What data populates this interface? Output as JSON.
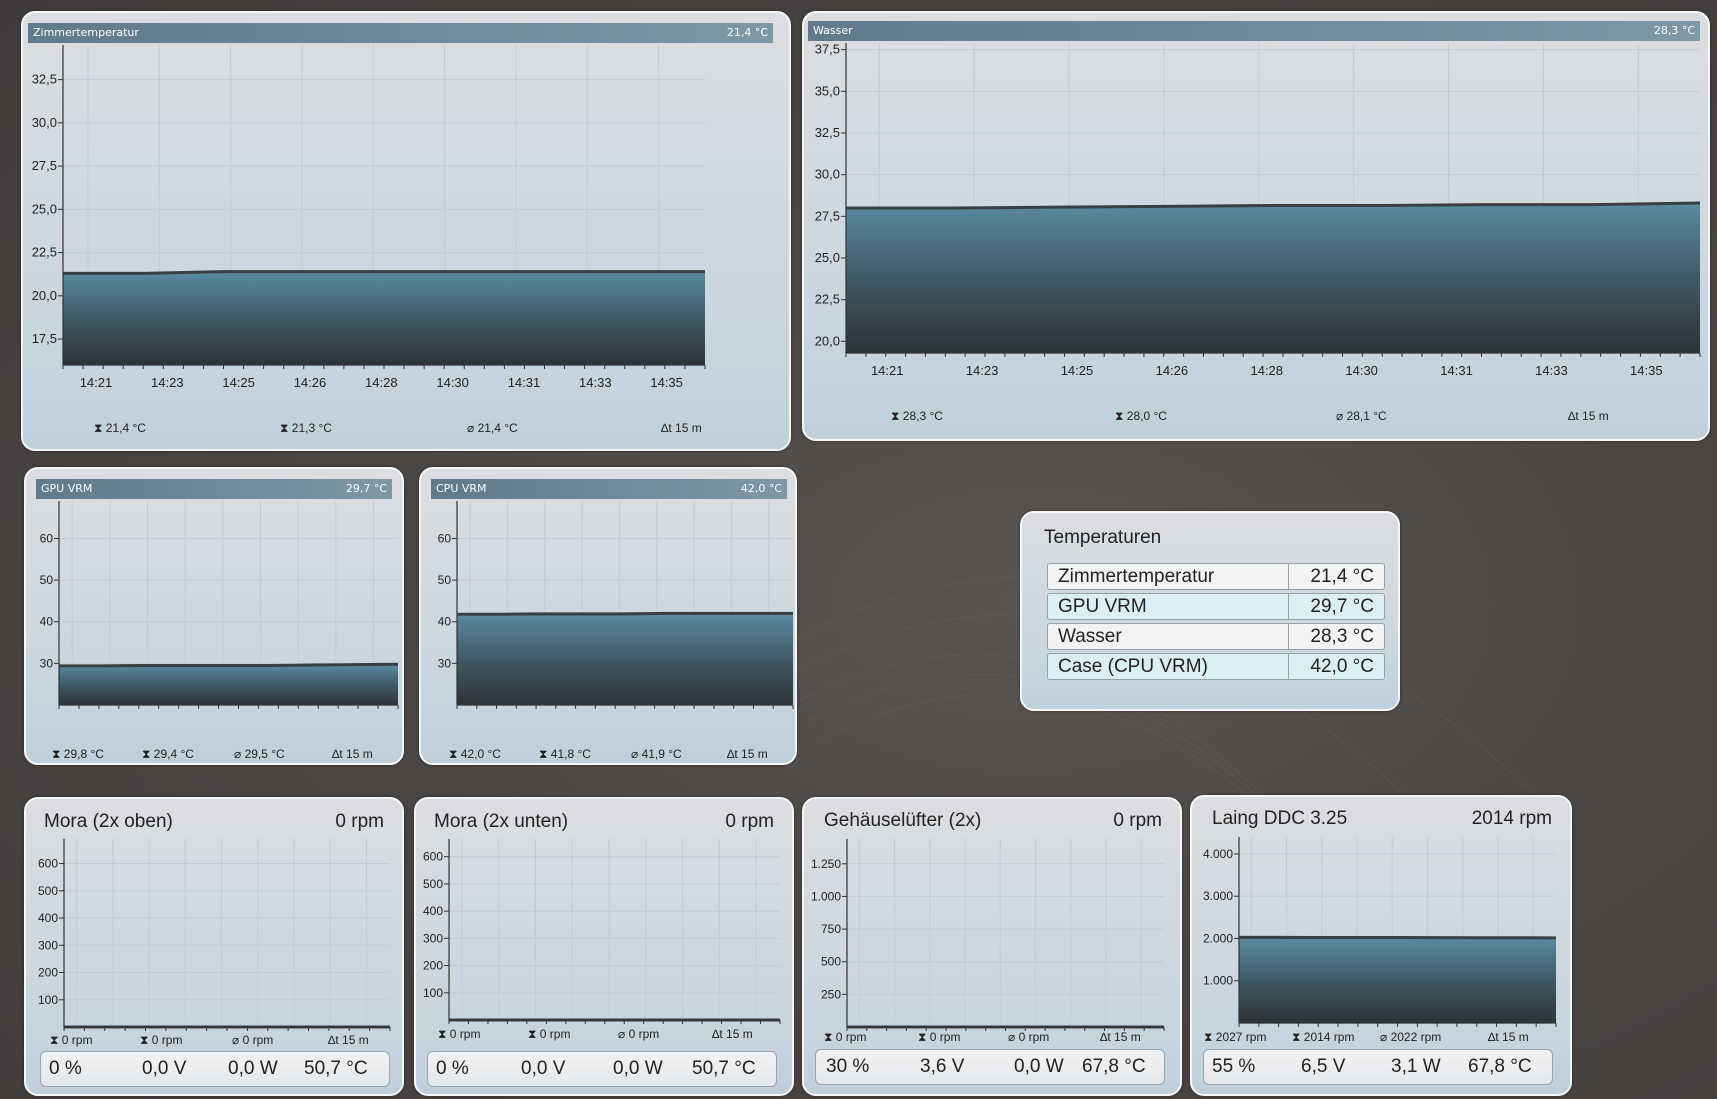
{
  "charts": {
    "zimmer": {
      "title": "Zimmertemperatur",
      "current": "21,4 °C",
      "stats": {
        "max": "21,4 °C",
        "min": "21,3 °C",
        "avg": "21,4 °C",
        "span": "15 m"
      }
    },
    "wasser": {
      "title": "Wasser",
      "current": "28,3 °C",
      "stats": {
        "max": "28,3 °C",
        "min": "28,0 °C",
        "avg": "28,1 °C",
        "span": "15 m"
      }
    },
    "gpuvrm": {
      "title": "GPU VRM",
      "current": "29,7 °C",
      "stats": {
        "max": "29,8 °C",
        "min": "29,4 °C",
        "avg": "29,5 °C",
        "span": "15 m"
      }
    },
    "cpuvrm": {
      "title": "CPU VRM",
      "current": "42,0 °C",
      "stats": {
        "max": "42,0 °C",
        "min": "41,8 °C",
        "avg": "41,9 °C",
        "span": "15 m"
      }
    }
  },
  "fans": {
    "mora_oben": {
      "title": "Mora (2x oben)",
      "current": "0 rpm",
      "stats": {
        "max": "0 rpm",
        "min": "0 rpm",
        "avg": "0 rpm",
        "span": "15 m"
      },
      "footer": {
        "percent": "0 %",
        "voltage": "0,0 V",
        "power": "0,0 W",
        "temp": "50,7 °C"
      }
    },
    "mora_unten": {
      "title": "Mora (2x unten)",
      "current": "0 rpm",
      "stats": {
        "max": "0 rpm",
        "min": "0 rpm",
        "avg": "0 rpm",
        "span": "15 m"
      },
      "footer": {
        "percent": "0 %",
        "voltage": "0,0 V",
        "power": "0,0 W",
        "temp": "50,7 °C"
      }
    },
    "gehaeuse": {
      "title": "Gehäuselüfter (2x)",
      "current": "0 rpm",
      "stats": {
        "max": "0 rpm",
        "min": "0 rpm",
        "avg": "0 rpm",
        "span": "15 m"
      },
      "footer": {
        "percent": "30 %",
        "voltage": "3,6 V",
        "power": "0,0 W",
        "temp": "67,8 °C"
      }
    },
    "laing": {
      "title": "Laing DDC 3.25",
      "current": "2014 rpm",
      "stats": {
        "max": "2027 rpm",
        "min": "2014 rpm",
        "avg": "2022 rpm",
        "span": "15 m"
      },
      "footer": {
        "percent": "55 %",
        "voltage": "6,5 V",
        "power": "3,1 W",
        "temp": "67,8 °C"
      }
    }
  },
  "temperaturen": {
    "title": "Temperaturen",
    "rows": [
      {
        "name": "Zimmertemperatur",
        "value": "21,4 °C"
      },
      {
        "name": "GPU VRM",
        "value": "29,7 °C"
      },
      {
        "name": "Wasser",
        "value": "28,3 °C"
      },
      {
        "name": "Case (CPU VRM)",
        "value": "42,0 °C"
      }
    ]
  },
  "chart_data": [
    {
      "id": "zimmer",
      "type": "area",
      "x": [
        "14:21",
        "14:23",
        "14:25",
        "14:26",
        "14:28",
        "14:30",
        "14:31",
        "14:33",
        "14:35"
      ],
      "yticks": [
        "17,5",
        "20,0",
        "22,5",
        "25,0",
        "27,5",
        "30,0",
        "32,5"
      ],
      "ylim": [
        16.0,
        34.5
      ],
      "values": [
        21.3,
        21.3,
        21.4,
        21.4,
        21.4,
        21.4,
        21.4,
        21.4,
        21.4
      ]
    },
    {
      "id": "wasser",
      "type": "area",
      "x": [
        "14:21",
        "14:23",
        "14:25",
        "14:26",
        "14:28",
        "14:30",
        "14:31",
        "14:33",
        "14:35"
      ],
      "yticks": [
        "20,0",
        "22,5",
        "25,0",
        "27,5",
        "30,0",
        "32,5",
        "35,0",
        "37,5"
      ],
      "ylim": [
        19.3,
        37.9
      ],
      "values": [
        28.0,
        28.0,
        28.05,
        28.1,
        28.15,
        28.15,
        28.2,
        28.2,
        28.3
      ]
    },
    {
      "id": "gpuvrm",
      "type": "area",
      "x": [],
      "yticks": [
        "30",
        "40",
        "50",
        "60"
      ],
      "ylim": [
        20,
        69
      ],
      "values": [
        29.4,
        29.4,
        29.5,
        29.5,
        29.5,
        29.5,
        29.6,
        29.7,
        29.8
      ]
    },
    {
      "id": "cpuvrm",
      "type": "area",
      "x": [],
      "yticks": [
        "30",
        "40",
        "50",
        "60"
      ],
      "ylim": [
        20,
        69
      ],
      "values": [
        41.8,
        41.8,
        41.9,
        41.9,
        41.9,
        42.0,
        42.0,
        42.0,
        42.0
      ]
    },
    {
      "id": "mora_oben",
      "type": "area",
      "x": [],
      "yticks": [
        "100",
        "200",
        "300",
        "400",
        "500",
        "600"
      ],
      "ylim": [
        0,
        690
      ],
      "values": [
        0,
        0,
        0,
        0,
        0,
        0,
        0,
        0,
        0
      ]
    },
    {
      "id": "mora_unten",
      "type": "area",
      "x": [],
      "yticks": [
        "100",
        "200",
        "300",
        "400",
        "500",
        "600"
      ],
      "ylim": [
        0,
        665
      ],
      "values": [
        0,
        0,
        0,
        0,
        0,
        0,
        0,
        0,
        0
      ]
    },
    {
      "id": "gehaeuse",
      "type": "area",
      "x": [],
      "yticks": [
        "250",
        "500",
        "750",
        "1.000",
        "1.250"
      ],
      "ylim": [
        0,
        1440
      ],
      "values": [
        0,
        0,
        0,
        0,
        0,
        0,
        0,
        0,
        0
      ]
    },
    {
      "id": "laing",
      "type": "area",
      "x": [],
      "yticks": [
        "1.000",
        "2.000",
        "3.000",
        "4.000"
      ],
      "ylim": [
        0,
        4400
      ],
      "values": [
        2027,
        2025,
        2024,
        2022,
        2022,
        2020,
        2018,
        2016,
        2014
      ]
    }
  ]
}
